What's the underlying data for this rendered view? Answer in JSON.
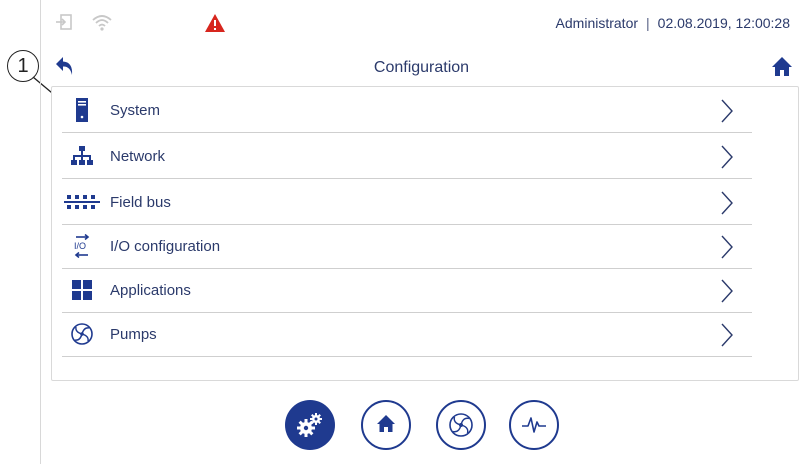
{
  "callout": {
    "number": "1"
  },
  "status": {
    "user": "Administrator",
    "separator": "|",
    "datetime": "02.08.2019, 12:00:28"
  },
  "header": {
    "title": "Configuration"
  },
  "menu": {
    "items": [
      {
        "label": "System",
        "icon": "server-icon"
      },
      {
        "label": "Network",
        "icon": "network-icon"
      },
      {
        "label": "Field bus",
        "icon": "fieldbus-icon"
      },
      {
        "label": "I/O configuration",
        "icon": "io-icon"
      },
      {
        "label": "Applications",
        "icon": "grid-icon"
      },
      {
        "label": "Pumps",
        "icon": "pump-icon"
      }
    ]
  },
  "bottom_nav": [
    {
      "name": "configuration",
      "icon": "gears-icon",
      "active": true
    },
    {
      "name": "home",
      "icon": "home-icon",
      "active": false
    },
    {
      "name": "pumps",
      "icon": "pump-icon",
      "active": false
    },
    {
      "name": "signal",
      "icon": "waveform-icon",
      "active": false
    }
  ],
  "colors": {
    "accent": "#1f3a8f",
    "text": "#2b3a6b",
    "warning": "#d7261e",
    "muted_icon": "#c8c8c8",
    "divider": "#cfcfcf"
  }
}
